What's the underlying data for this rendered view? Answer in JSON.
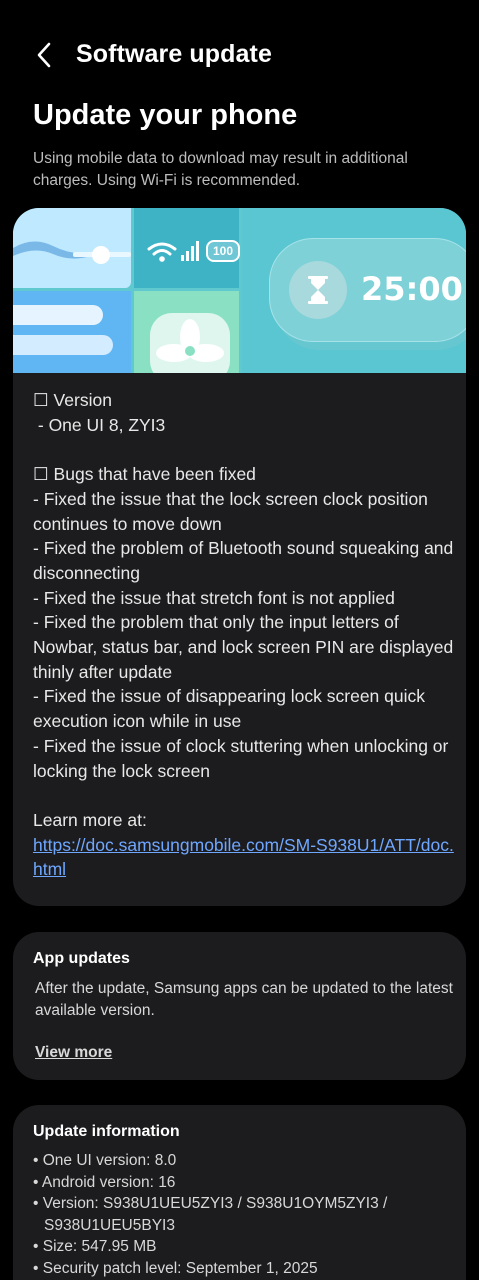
{
  "header": {
    "title": "Software update",
    "back_icon": "chevron-left-icon"
  },
  "page_title": "Update your phone",
  "notice": "Using mobile data to download may result in additional charges. Using Wi-Fi is recommended.",
  "banner": {
    "timer": "25:00",
    "battery": "100"
  },
  "release_notes": {
    "version_heading": "☐ Version",
    "version_value": " - One UI 8, ZYI3",
    "bugs_heading": "☐ Bugs that have been fixed",
    "bugs": [
      "- Fixed the issue that the lock screen clock position continues to move down",
      "- Fixed the problem of Bluetooth sound squeaking and disconnecting",
      "- Fixed the issue that stretch font is not applied",
      "- Fixed the problem that only the input letters of Nowbar, status bar, and lock screen PIN are displayed thinly after update",
      "- Fixed the issue of disappearing lock screen quick execution icon while in use",
      "- Fixed the issue of clock stuttering when unlocking or locking the lock screen"
    ],
    "learn_more": "Learn more at:",
    "link": "https://doc.samsungmobile.com/SM-S938U1/ATT/doc.html"
  },
  "app_updates": {
    "title": "App updates",
    "body": "After the update, Samsung apps can be updated to the latest available version.",
    "view_more": "View more"
  },
  "update_info": {
    "title": "Update information",
    "items": [
      "• One UI version: 8.0",
      "• Android version: 16",
      "• Version: S938U1UEU5ZYI3 / S938U1OYM5ZYI3 / S938U1UEU5BYI3",
      "• Size: 547.95 MB",
      "• Security patch level: September 1, 2025"
    ]
  },
  "colors": {
    "background": "#000000",
    "card": "#1c1c1e",
    "link": "#6fa7ff",
    "banner": "#5fc9cf"
  }
}
